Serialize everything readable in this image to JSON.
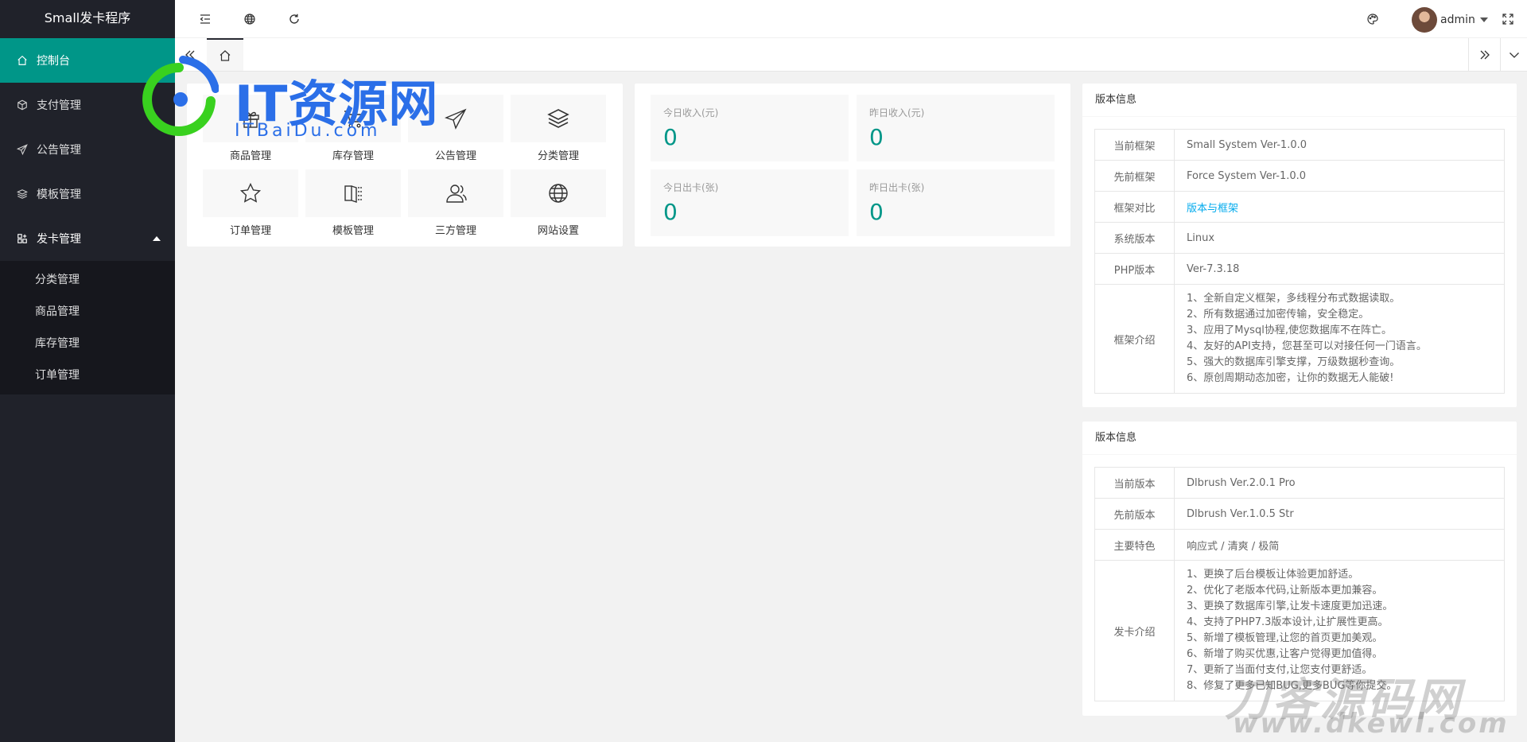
{
  "app": {
    "title": "Small发卡程序"
  },
  "sidebar": {
    "items": [
      {
        "label": "控制台",
        "icon": "home-icon",
        "active": true
      },
      {
        "label": "支付管理",
        "icon": "cube-icon"
      },
      {
        "label": "公告管理",
        "icon": "paper-plane-icon"
      },
      {
        "label": "模板管理",
        "icon": "layers-icon"
      },
      {
        "label": "发卡管理",
        "icon": "apps-icon",
        "expanded": true
      }
    ],
    "subitems": [
      {
        "label": "分类管理"
      },
      {
        "label": "商品管理"
      },
      {
        "label": "库存管理"
      },
      {
        "label": "订单管理"
      }
    ]
  },
  "header": {
    "user_name": "admin",
    "icons": [
      "menu-fold-icon",
      "website-icon",
      "refresh-icon",
      "theme-icon",
      "fullscreen-icon"
    ]
  },
  "shortcuts": [
    {
      "label": "商品管理",
      "icon": "gift-icon"
    },
    {
      "label": "库存管理",
      "icon": "cart-icon"
    },
    {
      "label": "公告管理",
      "icon": "paper-plane-icon"
    },
    {
      "label": "分类管理",
      "icon": "layers-icon"
    },
    {
      "label": "订单管理",
      "icon": "star-icon"
    },
    {
      "label": "模板管理",
      "icon": "template-icon"
    },
    {
      "label": "三方管理",
      "icon": "users-icon"
    },
    {
      "label": "网站设置",
      "icon": "globe-icon"
    }
  ],
  "stats": [
    {
      "title": "今日收入(元)",
      "value": "0"
    },
    {
      "title": "昨日收入(元)",
      "value": "0"
    },
    {
      "title": "今日出卡(张)",
      "value": "0"
    },
    {
      "title": "昨日出卡(张)",
      "value": "0"
    }
  ],
  "panel1": {
    "title": "版本信息",
    "rows": [
      {
        "key": "当前框架",
        "value": "Small System Ver-1.0.0"
      },
      {
        "key": "先前框架",
        "value": "Force System Ver-1.0.0"
      },
      {
        "key": "框架对比",
        "value": "版本与框架"
      },
      {
        "key": "系统版本",
        "value": "Linux"
      },
      {
        "key": "PHP版本",
        "value": "Ver-7.3.18"
      }
    ],
    "intro_key": "框架介绍",
    "intro_lines": [
      "1、全新自定义框架，多线程分布式数据读取。",
      "2、所有数据通过加密传输，安全稳定。",
      "3、应用了Mysql协程,使您数据库不在阵亡。",
      "4、友好的API支持，您甚至可以对接任何一门语言。",
      "5、强大的数据库引擎支撑，万级数据秒查询。",
      "6、原创周期动态加密，让你的数据无人能破!"
    ]
  },
  "panel2": {
    "title": "版本信息",
    "rows": [
      {
        "key": "当前版本",
        "value": "Dlbrush Ver.2.0.1 Pro"
      },
      {
        "key": "先前版本",
        "value": "Dlbrush Ver.1.0.5 Str"
      },
      {
        "key": "主要特色",
        "value": "响应式 / 清爽 / 极简"
      }
    ],
    "intro_key": "发卡介绍",
    "intro_lines": [
      "1、更换了后台模板让体验更加舒适。",
      "2、优化了老版本代码,让新版本更加兼容。",
      "3、更换了数据库引擎,让发卡速度更加迅速。",
      "4、支持了PHP7.3版本设计,让扩展性更高。",
      "5、新增了模板管理,让您的首页更加美观。",
      "6、新增了购买优惠,让客户觉得更加值得。",
      "7、更新了当面付支付,让您支付更舒适。",
      "8、修复了更多已知BUG,更多BUG等你提交。"
    ]
  },
  "watermarks": {
    "top_big": "IT资源网",
    "top_small": "ITBaiDu.com",
    "bottom_big": "刀客源码网",
    "bottom_small": "www.dkewl.com"
  },
  "colors": {
    "accent": "#009688",
    "sidebar": "#20222a",
    "link": "#01aaed"
  }
}
